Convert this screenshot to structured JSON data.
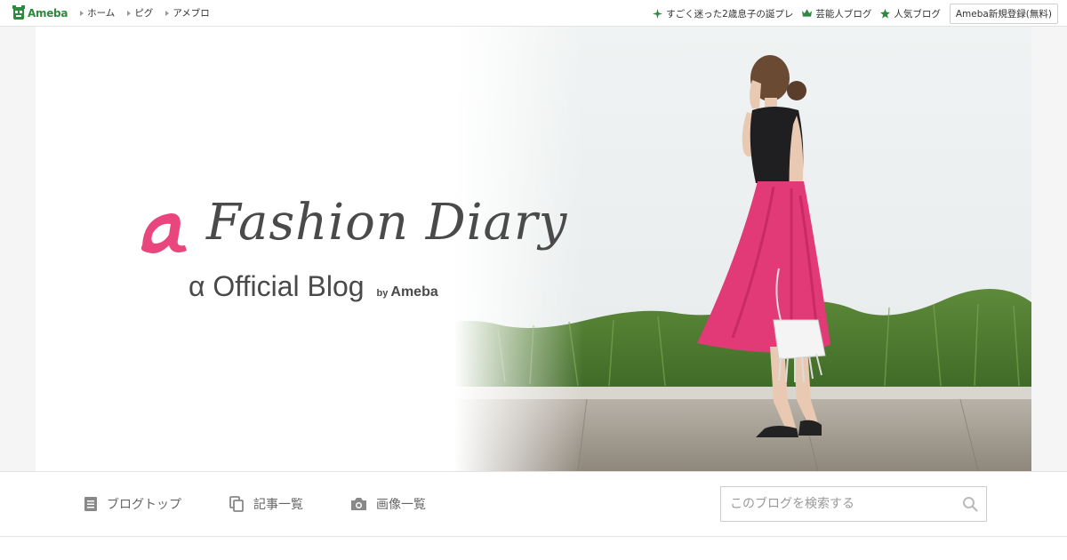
{
  "topbar": {
    "logo_text": "Ameba",
    "nav": [
      {
        "label": "ホーム"
      },
      {
        "label": "ピグ"
      },
      {
        "label": "アメブロ"
      }
    ],
    "right_links": [
      {
        "label": "すごく迷った2歳息子の誕プレ",
        "icon": "sparkle-icon"
      },
      {
        "label": "芸能人ブログ",
        "icon": "crown-icon"
      },
      {
        "label": "人気ブログ",
        "icon": "star-icon"
      }
    ],
    "signup_label": "Ameba新規登録(無料)",
    "accent": "#2d8a3e"
  },
  "hero": {
    "title_initial": "a",
    "title": "Fashion Diary",
    "subtitle": "α  Official Blog",
    "by": "by",
    "by_brand": "Ameba",
    "title_accent": "#e8467c"
  },
  "subnav": {
    "items": [
      {
        "label": "ブログトップ",
        "icon": "document-icon"
      },
      {
        "label": "記事一覧",
        "icon": "copy-icon"
      },
      {
        "label": "画像一覧",
        "icon": "camera-icon"
      }
    ],
    "search_placeholder": "このブログを検索する"
  }
}
